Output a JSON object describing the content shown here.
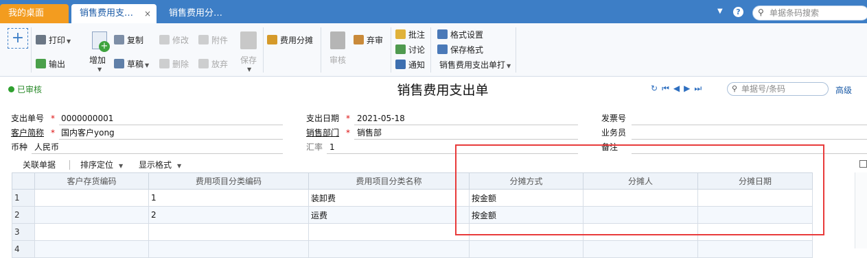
{
  "tabs": {
    "home": "我的桌面",
    "active": "销售费用支…",
    "close": "×",
    "other": "销售费用分…"
  },
  "topbar": {
    "help": "?",
    "search_placeholder": "单据条码搜索"
  },
  "toolbar": {
    "print": "打印",
    "export": "输出",
    "add": "增加",
    "copy": "复制",
    "draft": "草稿",
    "modify": "修改",
    "delete": "删除",
    "attach": "附件",
    "abandon": "放弃",
    "save": "保存",
    "expense_allocate": "费用分摊",
    "audit": "审核",
    "unaudit": "弃审",
    "annotate": "批注",
    "discuss": "讨论",
    "notify": "通知",
    "format_settings": "格式设置",
    "save_format": "保存格式",
    "print_template": "销售费用支出单打"
  },
  "status": {
    "label": "已审核",
    "color": "#2fa02f"
  },
  "page_title": "销售费用支出单",
  "bill_search": {
    "placeholder": "单据号/条码",
    "advanced": "高级"
  },
  "header": {
    "bill_no": {
      "label": "支出单号",
      "value": "0000000001"
    },
    "customer": {
      "label": "客户简称",
      "value": "国内客户yong"
    },
    "currency": {
      "label": "币种",
      "value": "人民币"
    },
    "date": {
      "label": "支出日期",
      "value": "2021-05-18"
    },
    "department": {
      "label": "销售部门",
      "value": "销售部"
    },
    "exchange_rate": {
      "label": "汇率",
      "value": "1"
    },
    "invoice_no": {
      "label": "发票号",
      "value": ""
    },
    "salesperson": {
      "label": "业务员",
      "value": ""
    },
    "remark": {
      "label": "备注",
      "value": ""
    },
    "required_mark": "*"
  },
  "grid_toolbar": {
    "related": "关联单据",
    "sort": "排序定位",
    "display": "显示格式"
  },
  "grid": {
    "columns": [
      "客户存货编码",
      "费用项目分类编码",
      "费用项目分类名称",
      "分摊方式",
      "分摊人",
      "分摊日期"
    ],
    "rows": [
      {
        "no": "1",
        "cust_code": "",
        "cat_code": "1",
        "cat_name": "装卸费",
        "method": "按金额",
        "person": "",
        "date": ""
      },
      {
        "no": "2",
        "cust_code": "",
        "cat_code": "2",
        "cat_name": "运费",
        "method": "按金额",
        "person": "",
        "date": ""
      },
      {
        "no": "3",
        "cust_code": "",
        "cat_code": "",
        "cat_name": "",
        "method": "",
        "person": "",
        "date": ""
      },
      {
        "no": "4",
        "cust_code": "",
        "cat_code": "",
        "cat_name": "",
        "method": "",
        "person": "",
        "date": ""
      }
    ]
  },
  "highlight_color": "#e83a3a",
  "accent_color": "#3d7ec6"
}
